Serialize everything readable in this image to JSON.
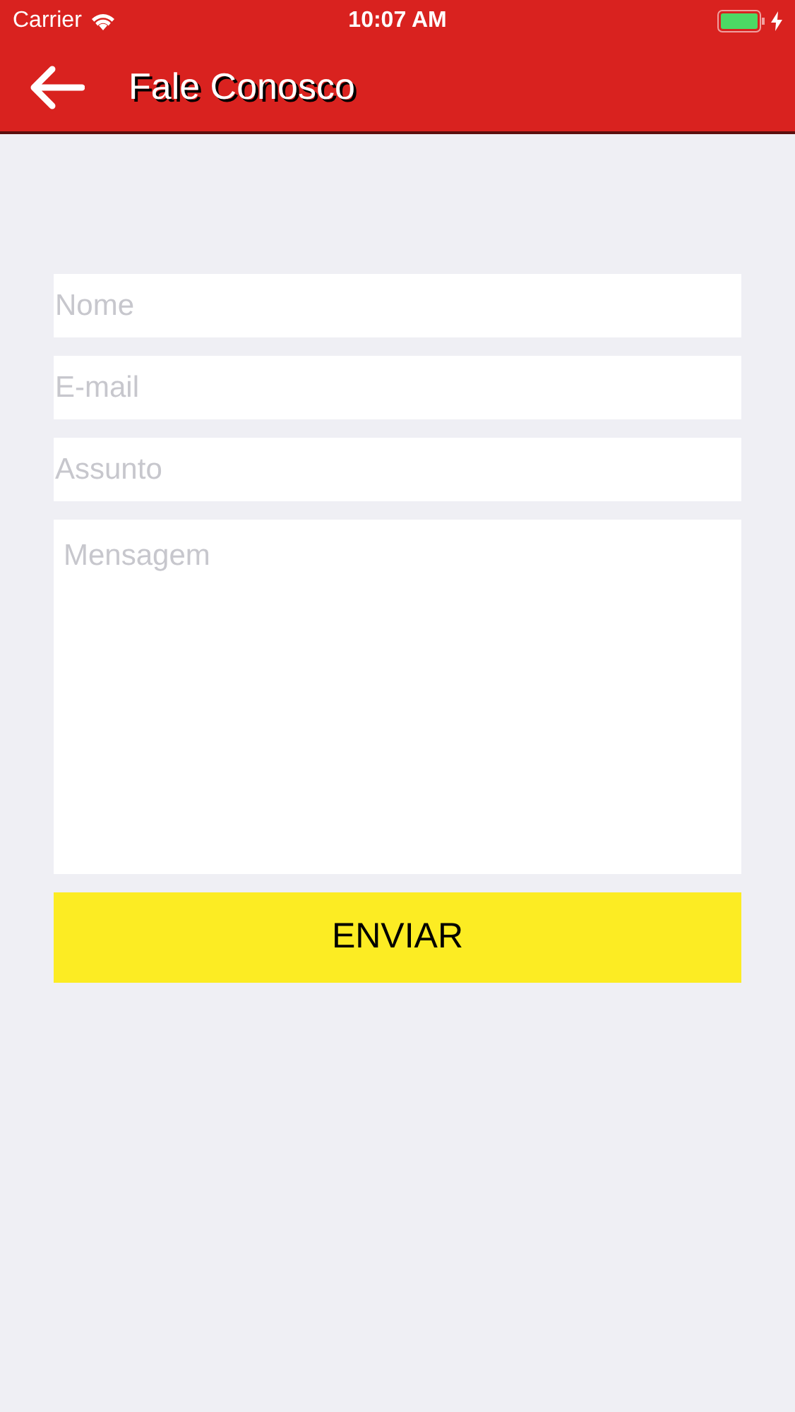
{
  "status_bar": {
    "carrier": "Carrier",
    "time": "10:07 AM"
  },
  "header": {
    "title": "Fale Conosco"
  },
  "fields": [
    {
      "kind": "input",
      "placeholder": "Nome"
    },
    {
      "kind": "input",
      "placeholder": "E-mail"
    },
    {
      "kind": "input",
      "placeholder": "Assunto"
    },
    {
      "kind": "textarea",
      "placeholder": "Mensagem"
    }
  ],
  "submit": {
    "label": "ENVIAR"
  }
}
